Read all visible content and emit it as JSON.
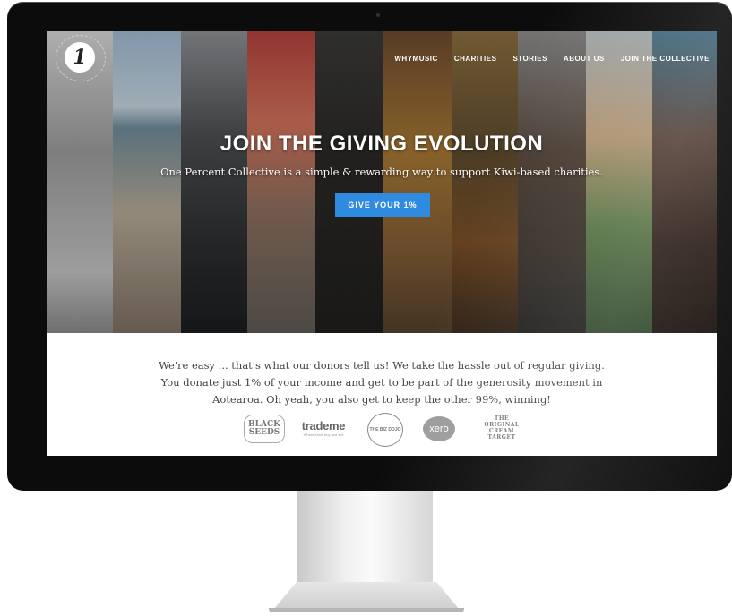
{
  "site": {
    "logo_glyph": "1",
    "nav": [
      "WHYMUSIC",
      "CHARITIES",
      "STORIES",
      "ABOUT US",
      "JOIN THE COLLECTIVE"
    ],
    "hero": {
      "headline": "JOIN THE GIVING EVOLUTION",
      "subline": "One Percent Collective is a simple & rewarding way to support Kiwi-based charities.",
      "cta": "GIVE YOUR 1%"
    },
    "about": {
      "text": "We're easy ... that's what our donors tell us! We take the hassle out of regular giving. You donate just 1% of your income and get to be part of the generosity movement in Aotearoa. Oh yeah, you also get to keep the other 99%, winning!"
    },
    "sponsors": {
      "s1": "BLACK SEEDS",
      "s2": "trademe",
      "s2_sub": "Where Kiwis buy and sell",
      "s3": "THE BIZ DOJO",
      "s4": "xero",
      "s5": "THE ORIGINAL CREAM TARGET"
    }
  },
  "colors": {
    "accent": "#2f8be0",
    "bezel": "#0c0c0c",
    "text": "#444444"
  }
}
